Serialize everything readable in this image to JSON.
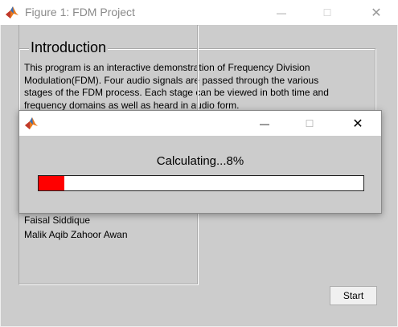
{
  "window": {
    "title": "Figure 1: FDM Project",
    "app_icon": "matlab-icon",
    "minimize_glyph": "—",
    "maximize_glyph": "☐",
    "close_glyph": "✕"
  },
  "introduction": {
    "title": "Introduction",
    "lines": [
      "This program is an interactive demonstration of Frequency Division",
      "Modulation(FDM). Four audio signals are passed through the various",
      "stages of the FDM process. Each stage can be viewed in both time and",
      "frequency domains as well as heard in audio form."
    ]
  },
  "authors": [
    "Faisal Siddique",
    "Malik Aqib Zahoor Awan"
  ],
  "start_label": "Start",
  "progress_dialog": {
    "app_icon": "matlab-icon",
    "message": "Calculating...8%",
    "progress_fraction": 0.08,
    "fill_color": "#ff0000",
    "minimize_glyph": "—",
    "maximize_glyph": "☐",
    "close_glyph": "✕"
  }
}
